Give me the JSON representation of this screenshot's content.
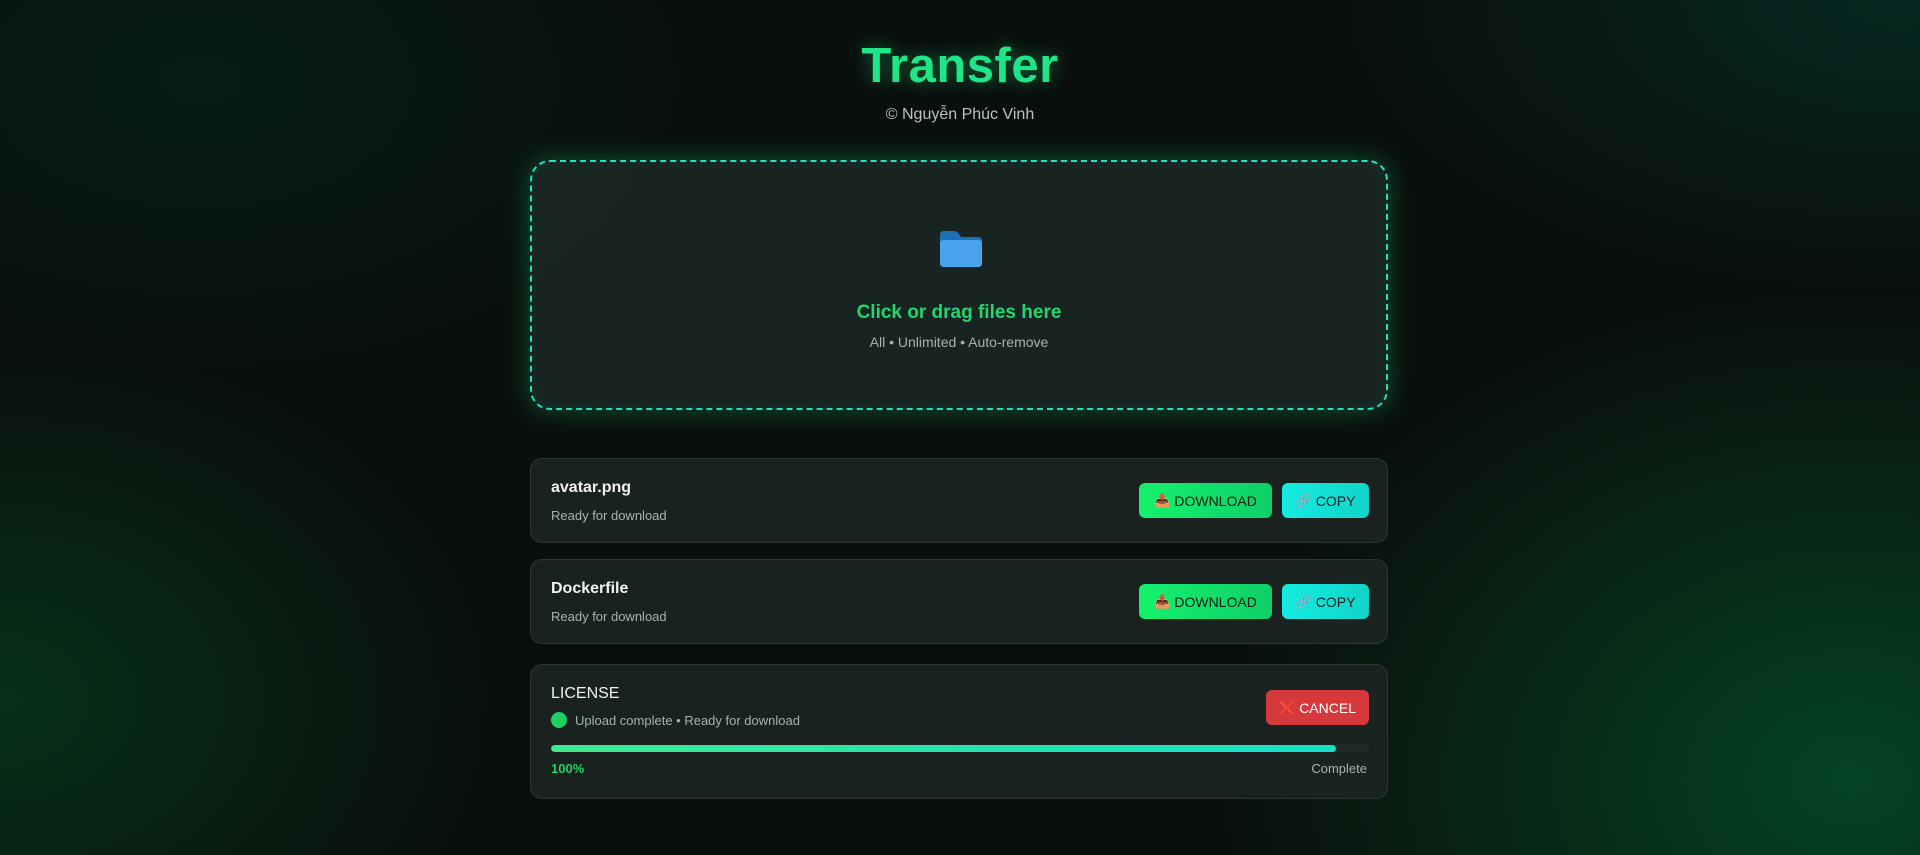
{
  "app": {
    "title": "Transfer",
    "copyright": "© Nguyễn Phúc Vinh"
  },
  "dropzone": {
    "icon": "folder-icon",
    "title": "Click or drag files here",
    "subtitle": "All • Unlimited • Auto-remove"
  },
  "files": [
    {
      "name": "avatar.png",
      "status": "Ready for download",
      "download_label": "DOWNLOAD",
      "download_icon": "📥",
      "copy_label": "COPY",
      "copy_icon": "🔗"
    },
    {
      "name": "Dockerfile",
      "status": "Ready for download",
      "download_label": "DOWNLOAD",
      "download_icon": "📥",
      "copy_label": "COPY",
      "copy_icon": "🔗"
    }
  ],
  "upload": {
    "name": "LICENSE",
    "status": "Upload complete • Ready for download",
    "cancel_label": "CANCEL",
    "cancel_icon": "❌",
    "progress_percent": 96,
    "progress_text": "100%",
    "progress_label": "Complete"
  },
  "colors": {
    "accent": "#1ee585",
    "download": "#14f16e",
    "copy": "#14ece0",
    "cancel": "#d6393c",
    "dropzone_border": "#1ee3c4"
  }
}
